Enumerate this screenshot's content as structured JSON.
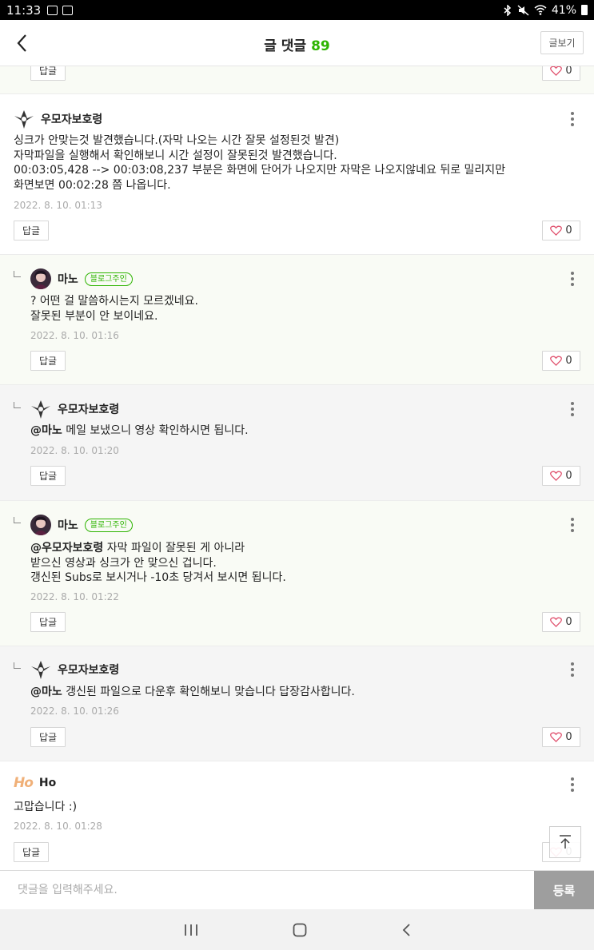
{
  "status": {
    "time": "11:33",
    "battery": "41%"
  },
  "header": {
    "title": "글 댓글",
    "count": "89",
    "view_post": "글보기"
  },
  "buttons": {
    "reply": "답글",
    "like_count": "0",
    "scroll_top": "top-arrow-icon"
  },
  "comments": [
    {
      "nick": "우모자보호령",
      "body": "싱크가 안맞는것 발견했습니다.(자막 나오는 시간 잘못 설정된것 발견)\n자막파일을 실행해서 확인해보니 시간 설정이 잘못된것 발견했습니다.\n00:03:05,428 --> 00:03:08,237 부분은 화면에 단어가 나오지만 자막은 나오지않네요 뒤로 밀리지만\n화면보면 00:02:28 쯤 나옵니다.",
      "date": "2022. 8. 10. 01:13"
    },
    {
      "nick": "마노",
      "badge": "블로그주인",
      "body": "? 어떤 걸 말씀하시는지 모르겠네요.\n잘못된 부분이 안 보이네요.",
      "date": "2022. 8. 10. 01:16"
    },
    {
      "nick": "우모자보호령",
      "mention": "@마노",
      "body": " 메일 보냈으니 영상 확인하시면 됩니다.",
      "date": "2022. 8. 10. 01:20"
    },
    {
      "nick": "마노",
      "badge": "블로그주인",
      "mention": "@우모자보호령",
      "body": " 자막 파일이 잘못된 게 아니라\n받으신 영상과 싱크가 안 맞으신 겁니다.\n갱신된 Subs로 보시거나 -10초 당겨서 보시면 됩니다.",
      "date": "2022. 8. 10. 01:22"
    },
    {
      "nick": "우모자보호령",
      "mention": "@마노",
      "body": " 갱신된 파일으로 다운후 확인해보니 맞습니다 답장감사합니다.",
      "date": "2022. 8. 10. 01:26"
    },
    {
      "nick": "Ho",
      "logo": "Ho",
      "body": "고맙습니다 :)",
      "date": "2022. 8. 10. 01:28"
    }
  ],
  "input": {
    "placeholder": "댓글을 입력해주세요.",
    "submit": "등록"
  },
  "colors": {
    "accent": "#2db400",
    "heart": "#e0526e",
    "submit_bg": "#9e9e9e"
  }
}
